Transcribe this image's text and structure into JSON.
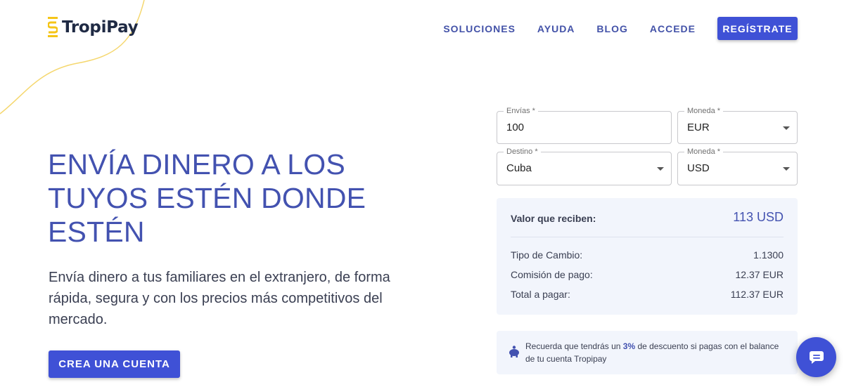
{
  "brand": {
    "name": "TropiPay",
    "primary_color": "#3f51d6",
    "accent_color": "#f5c518"
  },
  "nav": {
    "items": [
      {
        "label": "SOLUCIONES"
      },
      {
        "label": "AYUDA"
      },
      {
        "label": "BLOG"
      },
      {
        "label": "ACCEDE"
      }
    ],
    "register_label": "REGÍSTRATE"
  },
  "hero": {
    "title": "ENVÍA DINERO A LOS TUYOS ESTÉN DONDE ESTÉN",
    "subtitle": "Envía dinero a tus familiares en el extranjero, de forma rápida, segura y con los precios más competitivos del mercado.",
    "cta_label": "CREA UNA CUENTA"
  },
  "form": {
    "send": {
      "label": "Envías *",
      "value": "100"
    },
    "send_currency": {
      "label": "Moneda *",
      "value": "EUR"
    },
    "destination": {
      "label": "Destino *",
      "value": "Cuba"
    },
    "receive_currency": {
      "label": "Moneda *",
      "value": "USD"
    }
  },
  "summary": {
    "received_label": "Valor que reciben:",
    "received_value": "113 USD",
    "rows": [
      {
        "label": "Tipo de Cambio:",
        "value": "1.1300"
      },
      {
        "label": "Comisión de pago:",
        "value": "12.37 EUR"
      },
      {
        "label": "Total a pagar:",
        "value": "112.37 EUR"
      }
    ]
  },
  "notice": {
    "icon": "piggy-bank-icon",
    "text_before": "Recuerda que tendrás un ",
    "highlight": "3%",
    "text_after": " de descuento si pagas con el balance de tu cuenta Tropipay"
  },
  "chat": {
    "icon": "chat-icon"
  }
}
